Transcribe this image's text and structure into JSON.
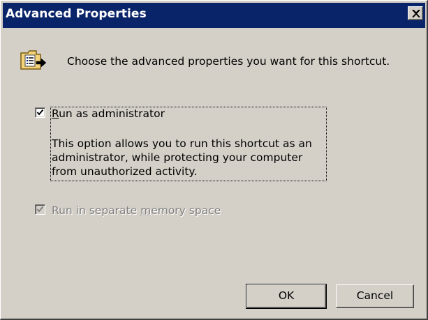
{
  "window": {
    "title": "Advanced Properties"
  },
  "header": {
    "icon": "shortcut-properties-icon",
    "text": "Choose the advanced properties you want for this shortcut."
  },
  "options": {
    "run_as_admin": {
      "label_first": "R",
      "label_rest": "un as administrator",
      "checked": true,
      "enabled": true,
      "description": "This option allows you to run this shortcut as an administrator, while protecting your computer from unauthorized activity."
    },
    "separate_memory": {
      "label_pre": "Run in separate ",
      "label_accel": "m",
      "label_post": "emory space",
      "checked": true,
      "enabled": false
    }
  },
  "buttons": {
    "ok": "OK",
    "cancel": "Cancel"
  },
  "colors": {
    "titlebar": "#0a246a",
    "face": "#d4d0c8",
    "disabled_text": "#808080"
  }
}
